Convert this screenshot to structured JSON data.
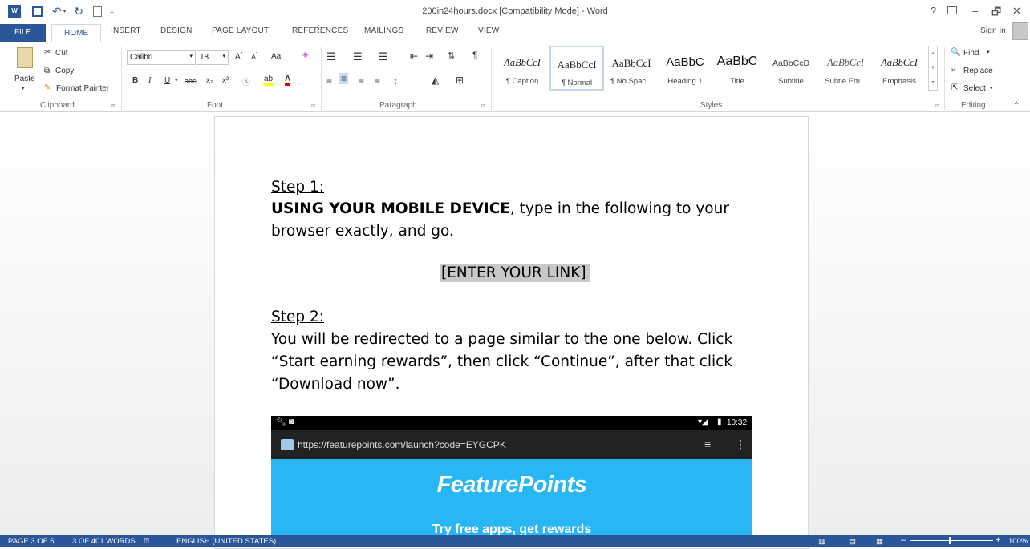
{
  "window": {
    "title": "200in24hours.docx [Compatibility Mode] - Word",
    "help": "?",
    "restore_icon": "ribbon-display-icon",
    "minimize": "–",
    "maximize": "🗗",
    "close": "✕"
  },
  "tabs": {
    "file": "FILE",
    "items": [
      "HOME",
      "INSERT",
      "DESIGN",
      "PAGE LAYOUT",
      "REFERENCES",
      "MAILINGS",
      "REVIEW",
      "VIEW"
    ],
    "sign_in": "Sign in"
  },
  "clipboard": {
    "paste": "Paste",
    "cut": "Cut",
    "copy": "Copy",
    "format_painter": "Format Painter",
    "label": "Clipboard"
  },
  "font": {
    "name": "Calibri",
    "size": "18",
    "case_btn": "Aa",
    "bold": "B",
    "italic": "I",
    "underline": "U",
    "strike": "abc",
    "subscript": "x₂",
    "superscript": "x²",
    "label": "Font"
  },
  "paragraph": {
    "label": "Paragraph"
  },
  "styles": {
    "items": [
      {
        "preview": "AaBbCcI",
        "name": "¶ Caption"
      },
      {
        "preview": "AaBbCcI",
        "name": "¶ Normal"
      },
      {
        "preview": "AaBbCcI",
        "name": "¶ No Spac..."
      },
      {
        "preview": "AaBbC",
        "name": "Heading 1"
      },
      {
        "preview": "AaBbC",
        "name": "Title"
      },
      {
        "preview": "AaBbCcD",
        "name": "Subtitle"
      },
      {
        "preview": "AaBbCcI",
        "name": "Subtle Em..."
      },
      {
        "preview": "AaBbCcI",
        "name": "Emphasis"
      }
    ],
    "label": "Styles"
  },
  "editing": {
    "find": "Find",
    "replace": "Replace",
    "select": "Select",
    "label": "Editing"
  },
  "document": {
    "step1_heading": "Step 1:",
    "step1_bold": "USING YOUR MOBILE DEVICE",
    "step1_rest": ", type in the following to your",
    "step1_line2": "browser exactly, and go.",
    "link_placeholder": "[ENTER YOUR LINK]",
    "step2_heading": "Step 2:",
    "step2_line1": "You will be redirected to a page similar to the one below. Click",
    "step2_line2": "“Start earning rewards”, then click “Continue”, after that click",
    "step2_line3": "“Download now”.",
    "screenshot": {
      "clock": "10:32",
      "url": "https://featurepoints.com/launch?code=EYGCPK",
      "brand": "FeaturePoints",
      "tagline": "Try free apps, get rewards"
    }
  },
  "statusbar": {
    "page": "PAGE 3 OF 5",
    "words": "3 OF 401 WORDS",
    "language": "ENGLISH (UNITED STATES)",
    "zoom": "100%"
  }
}
